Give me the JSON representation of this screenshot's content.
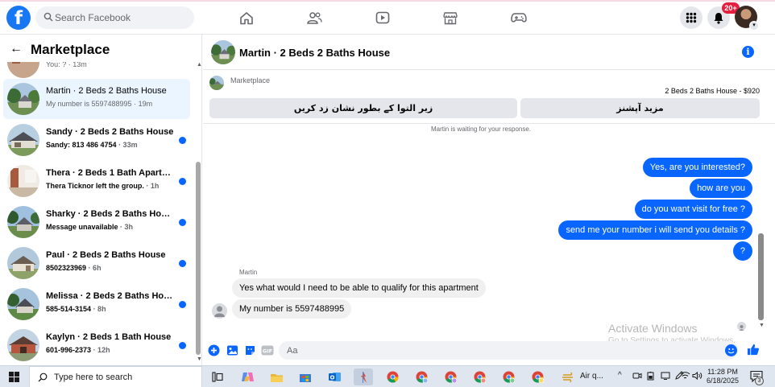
{
  "app": {
    "brand_letter": "f"
  },
  "search": {
    "placeholder": "Search Facebook"
  },
  "notifications": {
    "badge": "20+"
  },
  "sidebar": {
    "title": "Marketplace",
    "partial_item": {
      "sub": "You: ? · 13m"
    },
    "items": [
      {
        "title": "Martin · 2 Beds 2 Baths House",
        "sub": "My number is 5597488995",
        "time": " · 19m",
        "unread": false,
        "active": true
      },
      {
        "title": "Sandy · 2 Beds 2 Baths House",
        "sub": "Sandy: 813 486 4754",
        "time": " · 33m",
        "unread": true,
        "active": false
      },
      {
        "title": "Thera · 2 Beds 1 Bath Apartme...",
        "sub": "Thera Ticknor left the group.",
        "time": " · 1h",
        "unread": true,
        "active": false
      },
      {
        "title": "Sharky · 2 Beds 2 Baths House",
        "sub": "Message unavailable",
        "time": " · 3h",
        "unread": true,
        "active": false
      },
      {
        "title": "Paul · 2 Beds 2 Baths House",
        "sub": "8502323969",
        "time": " · 6h",
        "unread": true,
        "active": false
      },
      {
        "title": "Melissa · 2 Beds 2 Baths House",
        "sub": "585-514-3154",
        "time": " · 8h",
        "unread": true,
        "active": false
      },
      {
        "title": "Kaylyn · 2 Beds 1 Bath House",
        "sub": "601-996-2373",
        "time": " · 12h",
        "unread": true,
        "active": false
      }
    ]
  },
  "chat": {
    "title": "Martin · 2 Beds 2 Baths House",
    "listing_label": "Marketplace",
    "listing_price": "2 Beds 2 Baths House - $920",
    "btn_mark": "زیر التوا کے بطور نشان زد کریں",
    "btn_more": "مزید آپشنز",
    "waiting": "Martin is waiting for your response.",
    "sender_name": "Martin",
    "outgoing": [
      "Yes, are you interested?",
      "how are you",
      "do you want visit for free ?",
      "send me your number i will send you details ?",
      "?"
    ],
    "incoming": [
      "Yes what would I need to be able to qualify for this apartment",
      "My number is 5597488995"
    ],
    "input_placeholder": "Aa"
  },
  "watermark": {
    "line1": "Activate Windows",
    "line2": "Go to Settings to activate Windows."
  },
  "taskbar": {
    "search_text": "Type here to search",
    "app_label": "Air q...",
    "time": "11:28 PM",
    "date": "6/18/2025",
    "notif_count": "3"
  },
  "colors": {
    "brand": "#1877f2",
    "bubble_out": "#0866ff",
    "unread_dot": "#0866ff",
    "badge": "#e41e3f"
  }
}
